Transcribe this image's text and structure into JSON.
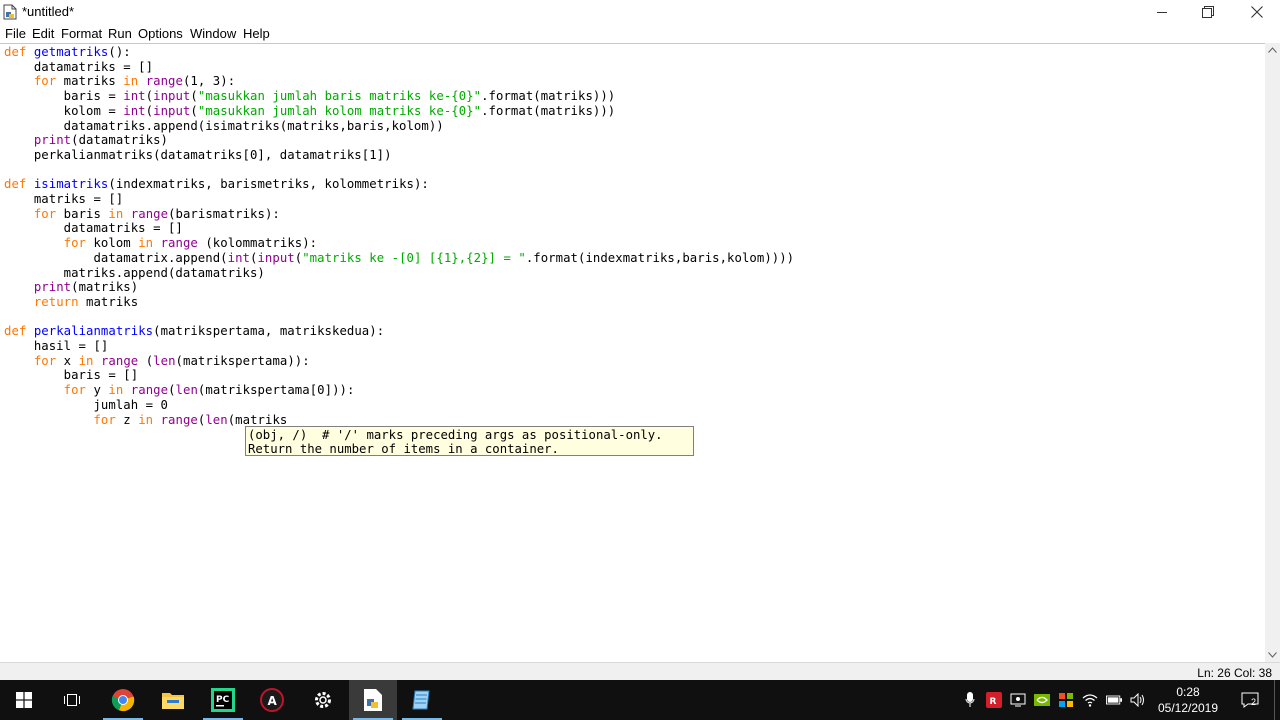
{
  "window": {
    "title": "*untitled*",
    "minimize_icon": "minimize-icon",
    "restore_icon": "restore-icon",
    "close_icon": "close-icon"
  },
  "menu": [
    "File",
    "Edit",
    "Format",
    "Run",
    "Options",
    "Window",
    "Help"
  ],
  "colors": {
    "keyword": "#ff7700",
    "builtin": "#900090",
    "definition": "#0000ff",
    "string": "#00aa00",
    "calltip_bg": "#ffffe0",
    "taskbar": "#101010"
  },
  "code_lines": [
    "def getmatriks():",
    "    datamatriks = []",
    "    for matriks in range(1, 3):",
    "        baris = int(input(\"masukkan jumlah baris matriks ke-{0}\".format(matriks)))",
    "        kolom = int(input(\"masukkan jumlah kolom matriks ke-{0}\".format(matriks)))",
    "        datamatriks.append(isimatriks(matriks,baris,kolom))",
    "    print(datamatriks)",
    "    perkalianmatriks(datamatriks[0], datamatriks[1])",
    "",
    "def isimatriks(indexmatriks, barismetriks, kolommetriks):",
    "    matriks = []",
    "    for baris in range(barismatriks):",
    "        datamatriks = []",
    "        for kolom in range (kolommatriks):",
    "            datamatrix.append(int(input(\"matriks ke -[0] [{1},{2}] = \".format(indexmatriks,baris,kolom))))",
    "        matriks.append(datamatriks)",
    "    print(matriks)",
    "    return matriks",
    "",
    "def perkalianmatriks(matrikspertama, matrikskedua):",
    "    hasil = []",
    "    for x in range (len(matrikspertama)):",
    "        baris = []",
    "        for y in range(len(matrikspertama[0])):",
    "            jumlah = 0",
    "            for z in range(len(matriks"
  ],
  "calltip": {
    "line1": "(obj, /)  # '/' marks preceding args as positional-only.",
    "line2": "Return the number of items in a container."
  },
  "status": {
    "position": "Ln: 26  Col: 38"
  },
  "taskbar": {
    "apps": [
      "windows-start-icon",
      "task-view-icon",
      "chrome-icon",
      "file-explorer-icon",
      "pycharm-icon",
      "app-a-icon",
      "settings-icon",
      "idle-editor-icon",
      "notepad-icon"
    ],
    "tray": [
      "microphone-icon",
      "app-tray-icon",
      "display-icon",
      "nvidia-icon",
      "shield-icon",
      "network-icon",
      "wifi-icon",
      "battery-icon",
      "volume-icon"
    ],
    "time": "0:28",
    "date": "05/12/2019",
    "notification_count": "2"
  }
}
